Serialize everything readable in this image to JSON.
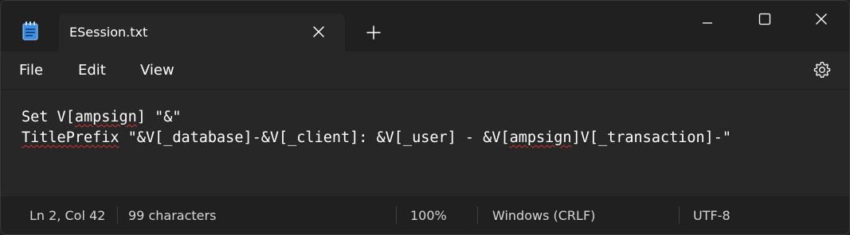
{
  "tab": {
    "title": "ESession.txt"
  },
  "menu": {
    "file": "File",
    "edit": "Edit",
    "view": "View"
  },
  "editor": {
    "line1": {
      "a": "Set V[",
      "b": "ampsign",
      "c": "] \"&\""
    },
    "line2": {
      "a": "TitlePrefix",
      "b": " \"&V[_database]-&V[_client]: &V[_user] - &V[",
      "c": "ampsign",
      "d": "]V[_transaction]-\""
    }
  },
  "status": {
    "position": "Ln 2, Col 42",
    "characters": "99 characters",
    "zoom": "100%",
    "line_ending": "Windows (CRLF)",
    "encoding": "UTF-8"
  },
  "icons": {
    "app": "notepad-icon",
    "close_tab": "close-icon",
    "new_tab": "plus-icon",
    "minimize": "minimize-icon",
    "maximize": "maximize-icon",
    "close_window": "close-icon",
    "settings": "gear-icon"
  },
  "colors": {
    "accent_icon": "#3a8ee6",
    "spellcheck_underline": "#d13438"
  }
}
